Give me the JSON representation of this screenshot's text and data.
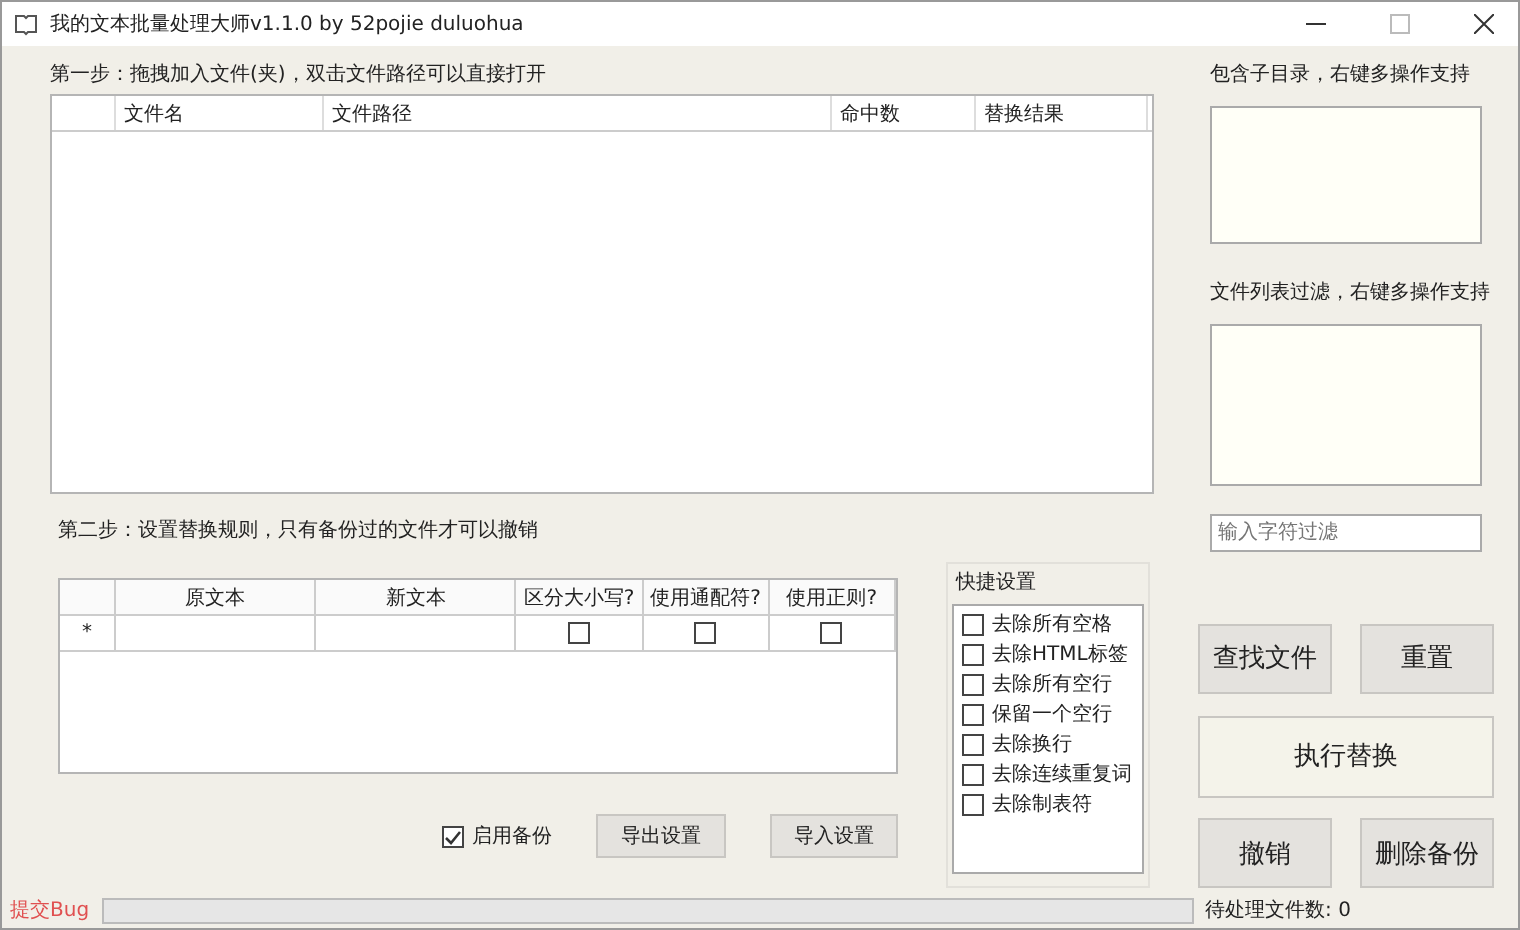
{
  "window": {
    "title": "我的文本批量处理大师v1.1.0 by 52pojie duluohua"
  },
  "step1": {
    "label": "第一步：拖拽加入文件(夹)，双击文件路径可以直接打开",
    "columns": [
      "文件名",
      "文件路径",
      "命中数",
      "替换结果"
    ]
  },
  "step2": {
    "label": "第二步：设置替换规则，只有备份过的文件才可以撤销",
    "columns": [
      "原文本",
      "新文本",
      "区分大小写?",
      "使用通配符?",
      "使用正则?"
    ],
    "rows": [
      {
        "marker": "*",
        "case_sensitive": false,
        "wildcard": false,
        "regex": false
      }
    ]
  },
  "backup": {
    "label": "启用备份",
    "checked": true
  },
  "export_button": "导出设置",
  "import_button": "导入设置",
  "quick_settings": {
    "title": "快捷设置",
    "items": [
      {
        "label": "去除所有空格",
        "checked": false
      },
      {
        "label": "去除HTML标签",
        "checked": false
      },
      {
        "label": "去除所有空行",
        "checked": false
      },
      {
        "label": "保留一个空行",
        "checked": false
      },
      {
        "label": "去除换行",
        "checked": false
      },
      {
        "label": "去除连续重复词",
        "checked": false
      },
      {
        "label": "去除制表符",
        "checked": false
      }
    ]
  },
  "subdir_label": "包含子目录，右键多操作支持",
  "filter_label": "文件列表过滤，右键多操作支持",
  "filter_input": {
    "placeholder": "输入字符过滤"
  },
  "buttons": {
    "find": "查找文件",
    "reset": "重置",
    "execute": "执行替换",
    "undo": "撤销",
    "delete_backup": "删除备份"
  },
  "status_bar": {
    "bug_link": "提交Bug",
    "progress": {
      "level": 0
    },
    "pending": "待处理文件数: 0"
  }
}
